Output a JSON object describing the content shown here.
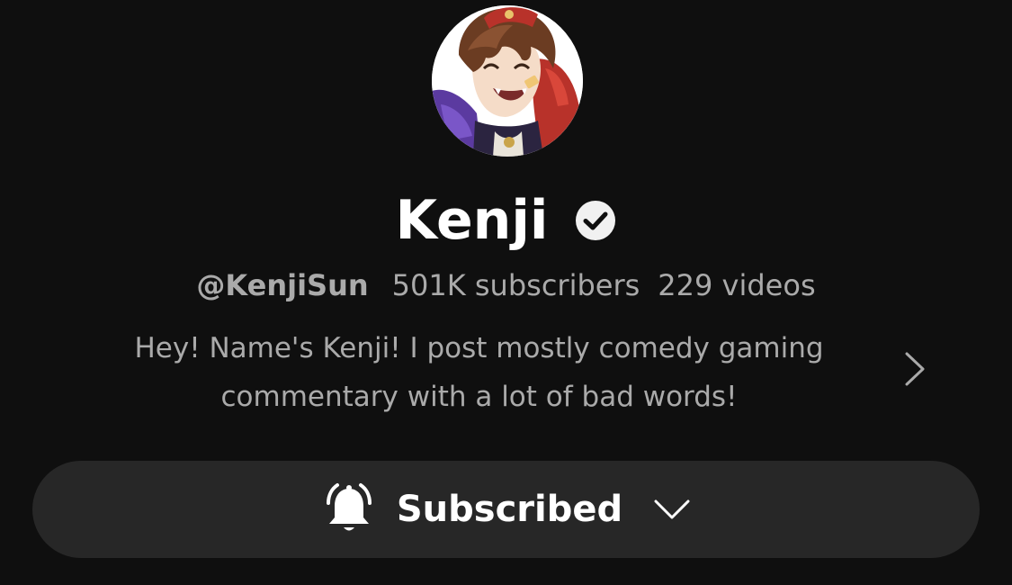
{
  "channel": {
    "name": "Kenji",
    "handle": "@KenjiSun",
    "subscribers": "501K subscribers",
    "videos": "229 videos",
    "description_line1": "Hey! Name's Kenji! I post mostly comedy gaming",
    "description_line2": "commentary with a lot of bad words!",
    "verified": true
  },
  "subscribe_button": {
    "label": "Subscribed",
    "icon": "bell-icon",
    "dropdown_icon": "chevron-down-icon"
  },
  "colors": {
    "background": "#0f0f0f",
    "button_bg": "#272727",
    "primary_text": "#ffffff",
    "secondary_text": "#aaaaaa"
  }
}
